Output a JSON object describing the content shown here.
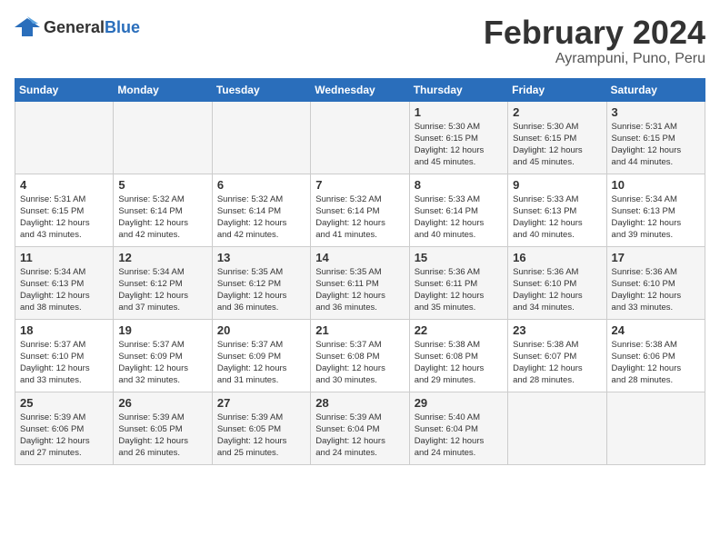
{
  "header": {
    "logo_general": "General",
    "logo_blue": "Blue",
    "month": "February 2024",
    "location": "Ayrampuni, Puno, Peru"
  },
  "weekdays": [
    "Sunday",
    "Monday",
    "Tuesday",
    "Wednesday",
    "Thursday",
    "Friday",
    "Saturday"
  ],
  "weeks": [
    [
      {
        "day": "",
        "info": ""
      },
      {
        "day": "",
        "info": ""
      },
      {
        "day": "",
        "info": ""
      },
      {
        "day": "",
        "info": ""
      },
      {
        "day": "1",
        "info": "Sunrise: 5:30 AM\nSunset: 6:15 PM\nDaylight: 12 hours\nand 45 minutes."
      },
      {
        "day": "2",
        "info": "Sunrise: 5:30 AM\nSunset: 6:15 PM\nDaylight: 12 hours\nand 45 minutes."
      },
      {
        "day": "3",
        "info": "Sunrise: 5:31 AM\nSunset: 6:15 PM\nDaylight: 12 hours\nand 44 minutes."
      }
    ],
    [
      {
        "day": "4",
        "info": "Sunrise: 5:31 AM\nSunset: 6:15 PM\nDaylight: 12 hours\nand 43 minutes."
      },
      {
        "day": "5",
        "info": "Sunrise: 5:32 AM\nSunset: 6:14 PM\nDaylight: 12 hours\nand 42 minutes."
      },
      {
        "day": "6",
        "info": "Sunrise: 5:32 AM\nSunset: 6:14 PM\nDaylight: 12 hours\nand 42 minutes."
      },
      {
        "day": "7",
        "info": "Sunrise: 5:32 AM\nSunset: 6:14 PM\nDaylight: 12 hours\nand 41 minutes."
      },
      {
        "day": "8",
        "info": "Sunrise: 5:33 AM\nSunset: 6:14 PM\nDaylight: 12 hours\nand 40 minutes."
      },
      {
        "day": "9",
        "info": "Sunrise: 5:33 AM\nSunset: 6:13 PM\nDaylight: 12 hours\nand 40 minutes."
      },
      {
        "day": "10",
        "info": "Sunrise: 5:34 AM\nSunset: 6:13 PM\nDaylight: 12 hours\nand 39 minutes."
      }
    ],
    [
      {
        "day": "11",
        "info": "Sunrise: 5:34 AM\nSunset: 6:13 PM\nDaylight: 12 hours\nand 38 minutes."
      },
      {
        "day": "12",
        "info": "Sunrise: 5:34 AM\nSunset: 6:12 PM\nDaylight: 12 hours\nand 37 minutes."
      },
      {
        "day": "13",
        "info": "Sunrise: 5:35 AM\nSunset: 6:12 PM\nDaylight: 12 hours\nand 36 minutes."
      },
      {
        "day": "14",
        "info": "Sunrise: 5:35 AM\nSunset: 6:11 PM\nDaylight: 12 hours\nand 36 minutes."
      },
      {
        "day": "15",
        "info": "Sunrise: 5:36 AM\nSunset: 6:11 PM\nDaylight: 12 hours\nand 35 minutes."
      },
      {
        "day": "16",
        "info": "Sunrise: 5:36 AM\nSunset: 6:10 PM\nDaylight: 12 hours\nand 34 minutes."
      },
      {
        "day": "17",
        "info": "Sunrise: 5:36 AM\nSunset: 6:10 PM\nDaylight: 12 hours\nand 33 minutes."
      }
    ],
    [
      {
        "day": "18",
        "info": "Sunrise: 5:37 AM\nSunset: 6:10 PM\nDaylight: 12 hours\nand 33 minutes."
      },
      {
        "day": "19",
        "info": "Sunrise: 5:37 AM\nSunset: 6:09 PM\nDaylight: 12 hours\nand 32 minutes."
      },
      {
        "day": "20",
        "info": "Sunrise: 5:37 AM\nSunset: 6:09 PM\nDaylight: 12 hours\nand 31 minutes."
      },
      {
        "day": "21",
        "info": "Sunrise: 5:37 AM\nSunset: 6:08 PM\nDaylight: 12 hours\nand 30 minutes."
      },
      {
        "day": "22",
        "info": "Sunrise: 5:38 AM\nSunset: 6:08 PM\nDaylight: 12 hours\nand 29 minutes."
      },
      {
        "day": "23",
        "info": "Sunrise: 5:38 AM\nSunset: 6:07 PM\nDaylight: 12 hours\nand 28 minutes."
      },
      {
        "day": "24",
        "info": "Sunrise: 5:38 AM\nSunset: 6:06 PM\nDaylight: 12 hours\nand 28 minutes."
      }
    ],
    [
      {
        "day": "25",
        "info": "Sunrise: 5:39 AM\nSunset: 6:06 PM\nDaylight: 12 hours\nand 27 minutes."
      },
      {
        "day": "26",
        "info": "Sunrise: 5:39 AM\nSunset: 6:05 PM\nDaylight: 12 hours\nand 26 minutes."
      },
      {
        "day": "27",
        "info": "Sunrise: 5:39 AM\nSunset: 6:05 PM\nDaylight: 12 hours\nand 25 minutes."
      },
      {
        "day": "28",
        "info": "Sunrise: 5:39 AM\nSunset: 6:04 PM\nDaylight: 12 hours\nand 24 minutes."
      },
      {
        "day": "29",
        "info": "Sunrise: 5:40 AM\nSunset: 6:04 PM\nDaylight: 12 hours\nand 24 minutes."
      },
      {
        "day": "",
        "info": ""
      },
      {
        "day": "",
        "info": ""
      }
    ]
  ]
}
